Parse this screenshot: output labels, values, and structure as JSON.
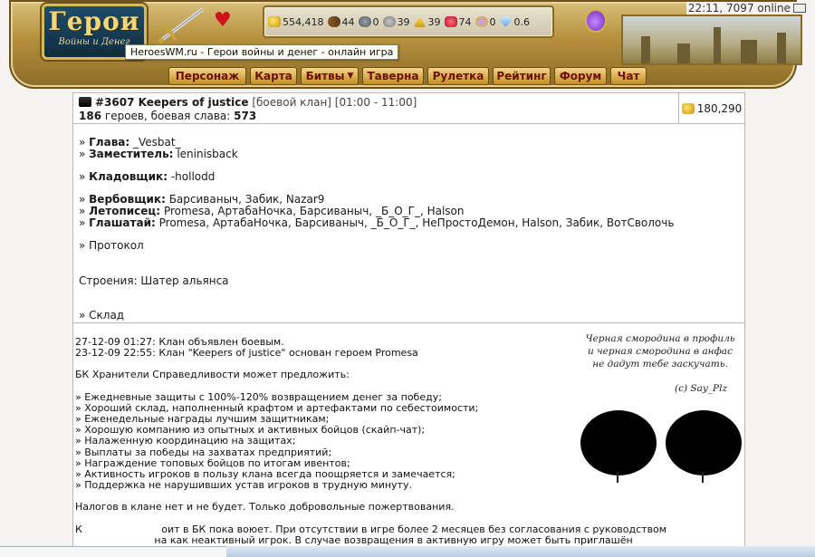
{
  "header": {
    "logo_title": "Герои",
    "logo_subtitle": "Войны и Денег",
    "clock": "22:11, 7097 online",
    "tooltip": "HeroesWM.ru - Герои войны и денег - онлайн игра",
    "resources": [
      {
        "icon": "gold-icon",
        "value": "554,418"
      },
      {
        "icon": "wood-icon",
        "value": "44"
      },
      {
        "icon": "ore-icon",
        "value": "0"
      },
      {
        "icon": "mercury-icon",
        "value": "39"
      },
      {
        "icon": "sulfur-icon",
        "value": "39"
      },
      {
        "icon": "crystal-icon",
        "value": "74"
      },
      {
        "icon": "gems-icon",
        "value": "0"
      },
      {
        "icon": "diamond-icon",
        "value": "0.6"
      }
    ]
  },
  "nav": {
    "items": [
      "Персонаж",
      "Карта",
      "Битвы",
      "Таверна",
      "Рулетка",
      "Рейтинг",
      "Форум",
      "Чат"
    ]
  },
  "clan": {
    "title": "#3607 Keepers of justice",
    "type": "[боевой клан] [01:00 - 11:00]",
    "heroes": "186",
    "heroes_label": "героев, боевая слава:",
    "glory": "573",
    "gold": "180,290",
    "head_label": "Глава:",
    "head": "_Vesbat_",
    "deputy_label": "Заместитель:",
    "deputy": "leninisback",
    "storekeeper_label": "Кладовщик:",
    "storekeeper": "-hollodd",
    "recruiter_label": "Вербовщик:",
    "recruiter": "Барсиваныч, Забик, Nazar9",
    "chronicler_label": "Летописец:",
    "chronicler": "Promesa, АртабаНочка, Барсиваныч, _Б_О_Г_, Halson",
    "herald_label": "Глашатай:",
    "herald": "Promesa, АртабаНочка, Барсиваныч, _Б_О_Г_, НеПростоДемон, Halson, Забик, ВотСволочь",
    "protocol": "» Протокол",
    "buildings": "Строения: Шатер альянса",
    "warehouse": "» Склад"
  },
  "description": {
    "lines": [
      "27-12-09 01:27: Клан объявлен боевым.",
      "23-12-09 22:55: Клан \"Keepers of justice\" основан героем Promesa",
      "",
      "БК Хранители Справедливости может предложить:",
      "",
      "» Ежедневные защиты с 100%-120% возвращением денег за победу;",
      "» Хороший склад, наполненный крафтом и артефактами по себестоимости;",
      "» Еженедельные награды лучшим защитникам;",
      "» Хорошую компанию из опытных и активных бойцов (скайп-чат);",
      "» Налаженную координацию на защитах;",
      "» Выплаты за победы на захватах предприятий;",
      "» Награждение топовых бойцов по итогам ивентов;",
      "» Активность игроков в пользу клана всегда поощряется и замечается;",
      "» Поддержка не нарушивших устав игроков в трудную минуту.",
      "",
      "Налогов в клане нет и не будет. Только добровольные пожертвования.",
      "",
      "К                         оит в БК пока воюет. При отсутствии в игре более 2 месяцев без согласования с руководством",
      "                         на как неактивный игрок. В случае возвращения в активную игру может быть приглашён"
    ]
  },
  "signature": {
    "lines": [
      "Черная смородина в профиль",
      "и черная смородина в анфас",
      "не дадут тебе заскучать."
    ],
    "author": "(c) Say_Plz"
  }
}
